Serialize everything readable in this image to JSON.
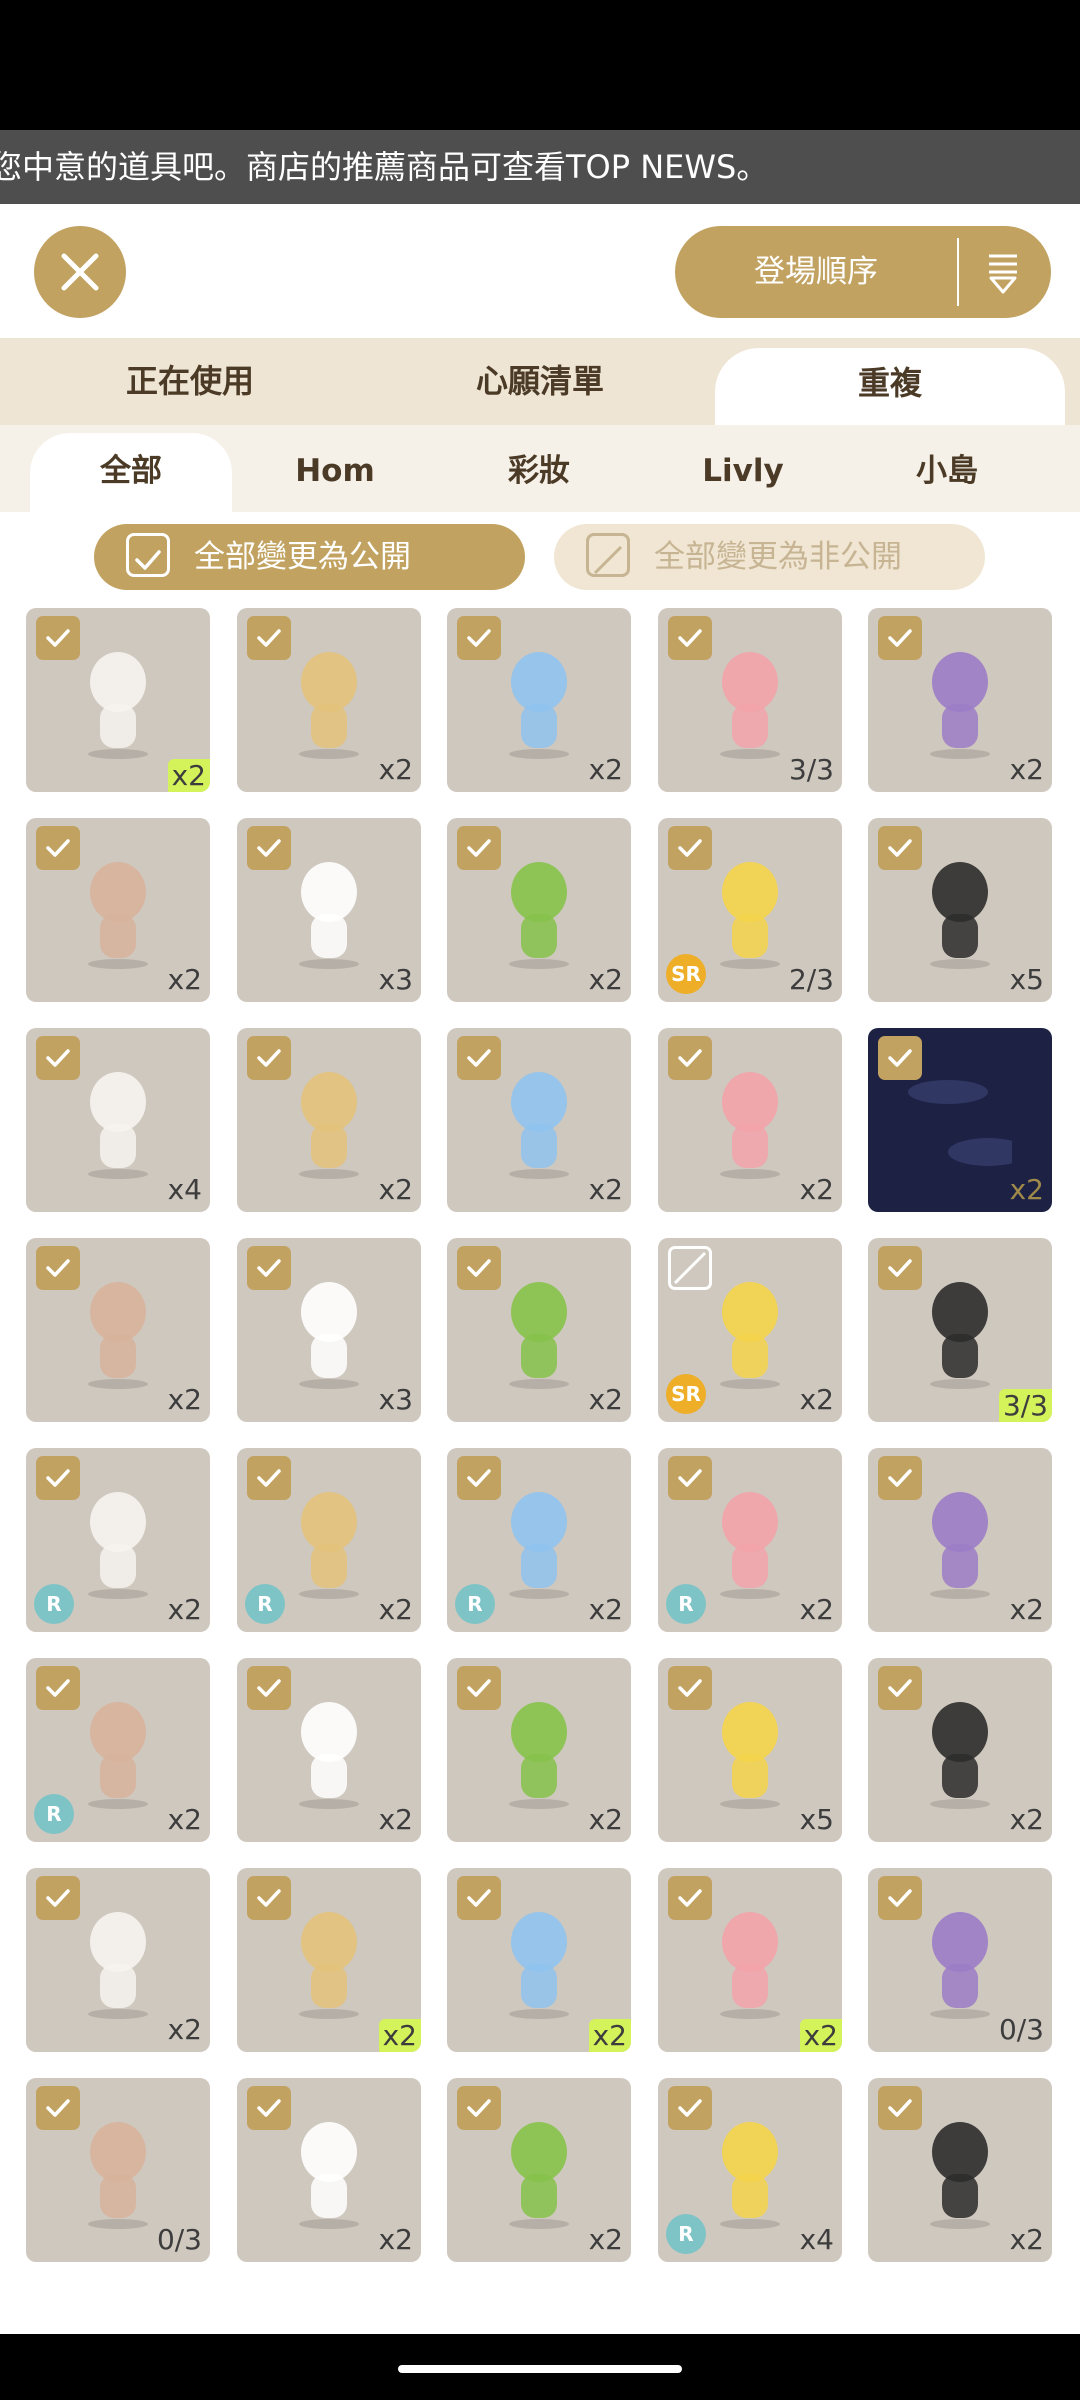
{
  "marquee_text": "您中意的道具吧。商店的推薦商品可查看TOP NEWS。",
  "sort": {
    "label": "登場順序"
  },
  "tabs": [
    {
      "label": "正在使用",
      "active": false
    },
    {
      "label": "心願清單",
      "active": false
    },
    {
      "label": "重複",
      "active": true
    }
  ],
  "subtabs": [
    {
      "label": "全部",
      "active": true
    },
    {
      "label": "Hom",
      "active": false
    },
    {
      "label": "彩妝",
      "active": false
    },
    {
      "label": "Livly",
      "active": false
    },
    {
      "label": "小島",
      "active": false
    }
  ],
  "publish": {
    "all_public": "全部變更為公開",
    "all_private": "全部變更為非公開"
  },
  "colors": {
    "accent": "#c1a260",
    "highlight": "#d4f25a",
    "rarity_R": "#7ec4c6",
    "rarity_SR": "#eeae28"
  },
  "items": [
    {
      "icon": "lanyard-badge-icon",
      "count": "x2",
      "highlight": true,
      "checked": true
    },
    {
      "icon": "headphones-icon",
      "count": "x2",
      "checked": true
    },
    {
      "icon": "ice-cubes-icon",
      "count": "x2",
      "checked": true
    },
    {
      "icon": "pink-jelly-icon",
      "count": "3/3",
      "checked": true
    },
    {
      "icon": "purple-fluffy-outfit-icon",
      "count": "x2",
      "checked": true
    },
    {
      "icon": "since-tag-icon",
      "count": "x2",
      "checked": true
    },
    {
      "icon": "milk-jug-icon",
      "count": "x3",
      "checked": true
    },
    {
      "icon": "green-leaf-icon",
      "count": "x2",
      "checked": true
    },
    {
      "icon": "party-hat-icon",
      "count": "2/3",
      "checked": true,
      "rarity": "SR"
    },
    {
      "icon": "overalls-outfit-icon",
      "count": "x5",
      "checked": true
    },
    {
      "icon": "sparkle-aura-icon",
      "count": "x4",
      "checked": true
    },
    {
      "icon": "veil-bow-icon",
      "count": "x2",
      "checked": true
    },
    {
      "icon": "star-wand-icon",
      "count": "x2",
      "checked": true
    },
    {
      "icon": "sun-hair-icon",
      "count": "x2",
      "checked": true
    },
    {
      "icon": "night-sky-background-icon",
      "count": "x2",
      "checked": true,
      "dark": true
    },
    {
      "icon": "glass-bottle-icon",
      "count": "x2",
      "checked": true
    },
    {
      "icon": "ornate-vase-icon",
      "count": "x3",
      "checked": true
    },
    {
      "icon": "feather-quill-icon",
      "count": "x2",
      "checked": true
    },
    {
      "icon": "light-bulb-icon",
      "count": "x2",
      "checked": false,
      "rarity": "SR"
    },
    {
      "icon": "ribbon-tree-icon",
      "count": "3/3",
      "highlight": true,
      "checked": true
    },
    {
      "icon": "clown-outfit-icon",
      "count": "x2",
      "checked": true,
      "rarity": "R"
    },
    {
      "icon": "balloon-dress-icon",
      "count": "x2",
      "checked": true,
      "rarity": "R"
    },
    {
      "icon": "green-bow-icon",
      "count": "x2",
      "checked": true,
      "rarity": "R"
    },
    {
      "icon": "cocktail-glass-icon",
      "count": "x2",
      "checked": true,
      "rarity": "R"
    },
    {
      "icon": "black-sweater-icon",
      "count": "x2",
      "checked": true
    },
    {
      "icon": "lollipop-head-icon",
      "count": "x2",
      "checked": true,
      "rarity": "R"
    },
    {
      "icon": "stepping-stones-icon",
      "count": "x2",
      "checked": true
    },
    {
      "icon": "flat-stones-icon",
      "count": "x2",
      "checked": true
    },
    {
      "icon": "ivy-ruins-icon",
      "count": "x5",
      "checked": true
    },
    {
      "icon": "rose-vase-icon",
      "count": "x2",
      "checked": true
    },
    {
      "icon": "white-top-icon",
      "count": "x2",
      "checked": true
    },
    {
      "icon": "slime-puddle-outfit-icon",
      "count": "x2",
      "highlight": true,
      "checked": true
    },
    {
      "icon": "purple-boots-icon",
      "count": "x2",
      "highlight": true,
      "checked": true
    },
    {
      "icon": "clear-umbrella-icon",
      "count": "x2",
      "highlight": true,
      "checked": true
    },
    {
      "icon": "dewy-leaf-icon",
      "count": "0/3",
      "checked": true
    },
    {
      "icon": "bubbles-icon",
      "count": "0/3",
      "checked": true
    },
    {
      "icon": "braided-hair-icon",
      "count": "x2",
      "checked": true
    },
    {
      "icon": "glass-dome-icon",
      "count": "x2",
      "checked": true
    },
    {
      "icon": "polka-wall-icon",
      "count": "x4",
      "checked": true,
      "rarity": "R"
    },
    {
      "icon": "cloud-mobile-icon",
      "count": "x2",
      "checked": true
    }
  ]
}
